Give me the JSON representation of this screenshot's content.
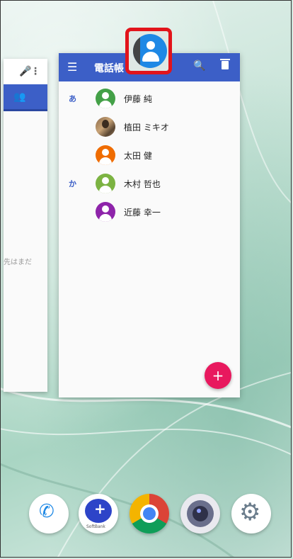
{
  "screen": {
    "description_free": true
  },
  "left_card": {
    "partial_text": "先はまだ"
  },
  "contacts": {
    "title": "電話帳",
    "accent": "#3c5fc7",
    "fab_label": "+",
    "rows": [
      {
        "section": "あ",
        "name": "伊藤 純",
        "avatar_color": "#43a047",
        "photo": false
      },
      {
        "section": "",
        "name": "植田 ミキオ",
        "avatar_color": "",
        "photo": true
      },
      {
        "section": "",
        "name": "太田 健",
        "avatar_color": "#ef6c00",
        "photo": false
      },
      {
        "section": "か",
        "name": "木村 哲也",
        "avatar_color": "#7cb342",
        "photo": false
      },
      {
        "section": "",
        "name": "近藤 幸一",
        "avatar_color": "#8e24aa",
        "photo": false
      }
    ]
  },
  "highlight_color": "#e2141b",
  "dock": {
    "items": [
      {
        "name": "phone-icon"
      },
      {
        "name": "softbank-message-icon",
        "label": "SoftBank"
      },
      {
        "name": "chrome-icon"
      },
      {
        "name": "camera-icon"
      },
      {
        "name": "settings-icon"
      }
    ]
  }
}
